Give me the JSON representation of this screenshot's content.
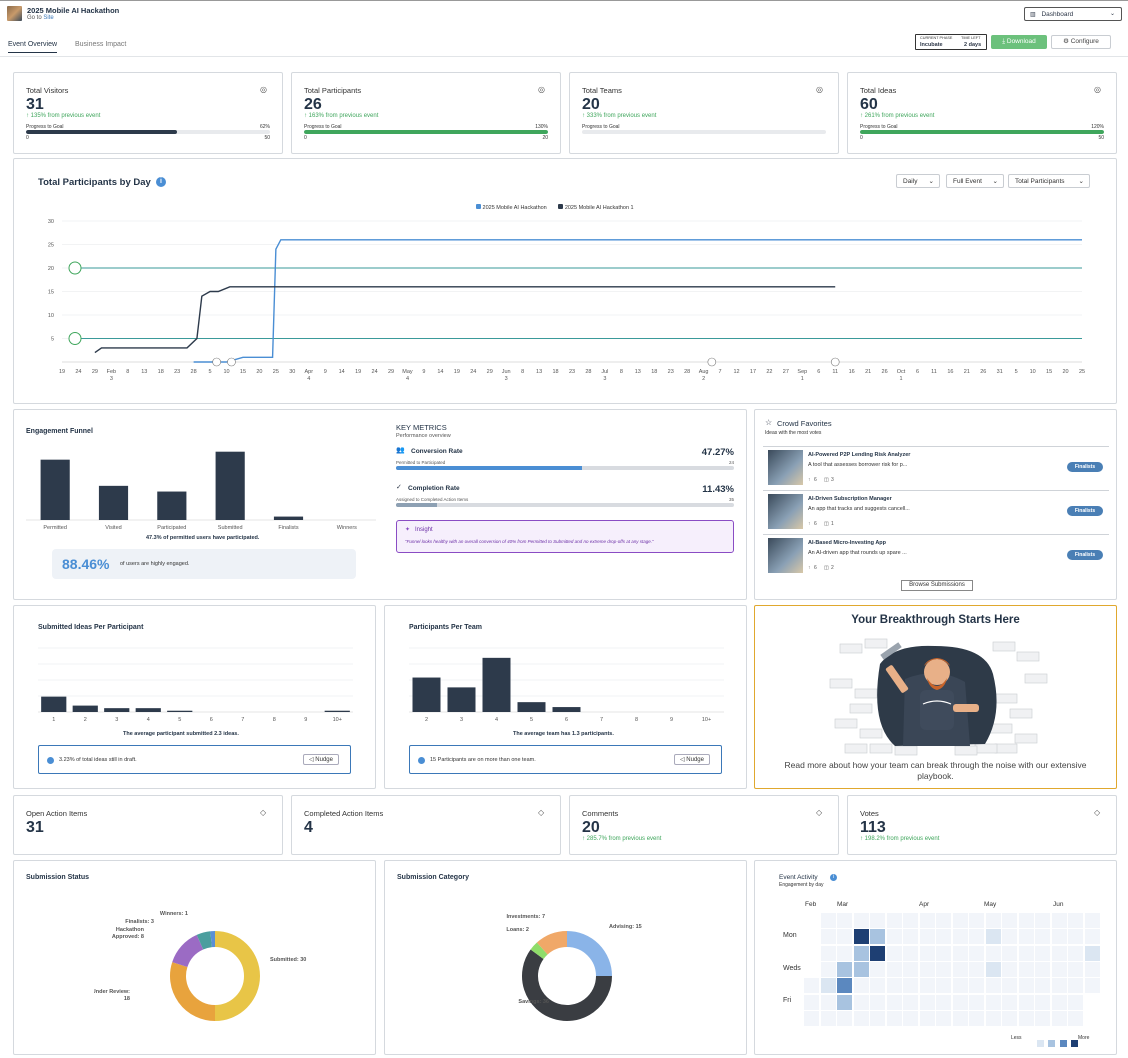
{
  "header": {
    "title": "2025 Mobile AI Hackathon",
    "goto_prefix": "Go to",
    "goto_link": "Site",
    "dashboard_select": "Dashboard"
  },
  "tabs": [
    {
      "label": "Event Overview"
    },
    {
      "label": "Business Impact"
    }
  ],
  "phase": {
    "current_label": "CURRENT PHASE",
    "current_value": "Incubate",
    "time_label": "TIME LEFT",
    "time_value": "2 days"
  },
  "actions": {
    "download": "Download",
    "configure": "Configure"
  },
  "kpis": [
    {
      "title": "Total Visitors",
      "value": "31",
      "delta": "↑ 135% from previous event",
      "goal_label": "Progress to Goal",
      "pct": "62%",
      "progress": 0.62,
      "min": "0",
      "max": "50",
      "bar_color": "#2d3a4b",
      "icon": "eye-icon"
    },
    {
      "title": "Total Participants",
      "value": "26",
      "delta": "↑ 163% from previous event",
      "goal_label": "Progress to Goal",
      "pct": "130%",
      "progress": 1.0,
      "min": "0",
      "max": "20",
      "bar_color": "#3fa65c",
      "icon": "users-icon"
    },
    {
      "title": "Total Teams",
      "value": "20",
      "delta": "↑ 333% from previous event",
      "goal_label": "Progress to Goal",
      "pct": "",
      "progress": 0,
      "min": "",
      "max": "",
      "bar_color": "#3fa65c",
      "icon": "handshake-icon"
    },
    {
      "title": "Total Ideas",
      "value": "60",
      "delta": "↑ 261% from previous event",
      "goal_label": "Progress to Goal",
      "pct": "120%",
      "progress": 1.0,
      "min": "0",
      "max": "50",
      "bar_color": "#3fa65c",
      "icon": "lightbulb-icon"
    }
  ],
  "line_chart": {
    "title": "Total Participants by Day",
    "selects": [
      "Daily",
      "Full Event",
      "Total Participants"
    ],
    "chart_data": {
      "type": "line",
      "ylim": [
        0,
        30
      ],
      "yticks": [
        5,
        10,
        15,
        20,
        25,
        30
      ],
      "x_ticks": [
        "19",
        "24",
        "29",
        "Feb",
        "8",
        "13",
        "18",
        "23",
        "28",
        "5",
        "10",
        "15",
        "20",
        "25",
        "30",
        "Apr",
        "9",
        "14",
        "19",
        "24",
        "29",
        "May",
        "9",
        "14",
        "19",
        "24",
        "29",
        "Jun",
        "8",
        "13",
        "18",
        "23",
        "28",
        "Jul",
        "8",
        "13",
        "18",
        "23",
        "28",
        "Aug",
        "7",
        "12",
        "17",
        "22",
        "27",
        "Sep",
        "6",
        "11",
        "16",
        "21",
        "26",
        "Oct",
        "6",
        "11",
        "16",
        "21",
        "26",
        "31",
        "5",
        "10",
        "15",
        "20",
        "25"
      ],
      "x_sub": {
        "3": "3",
        "15": "4",
        "21": "4",
        "27": "3",
        "33": "3",
        "39": "2",
        "45": "1",
        "51": "1"
      },
      "series": [
        {
          "name": "2025 Mobile AI Hackathon",
          "color": "#4a8ed4",
          "points": [
            [
              8,
              0
            ],
            [
              9,
              0
            ],
            [
              10,
              0
            ],
            [
              11,
              1
            ],
            [
              12,
              1
            ],
            [
              12.8,
              1
            ],
            [
              13,
              24
            ],
            [
              13.3,
              26
            ],
            [
              14,
              26
            ],
            [
              62,
              26
            ]
          ]
        },
        {
          "name": "2025 Mobile AI Hackathon 1",
          "color": "#2d3a4b",
          "points": [
            [
              2,
              2
            ],
            [
              2.4,
              3
            ],
            [
              6,
              3
            ],
            [
              7.6,
              3
            ],
            [
              8.2,
              5
            ],
            [
              8.5,
              14
            ],
            [
              9,
              15
            ],
            [
              9.5,
              15
            ],
            [
              10.2,
              16
            ],
            [
              11,
              16
            ],
            [
              47,
              16
            ]
          ]
        }
      ],
      "goal_lines": [
        20,
        5
      ]
    }
  },
  "funnel": {
    "title": "Engagement Funnel",
    "chart_data": {
      "type": "bar",
      "categories": [
        "Permitted",
        "Visited",
        "Participated",
        "Submitted",
        "Finalists",
        "Winners"
      ],
      "values": [
        53,
        30,
        25,
        60,
        3,
        0
      ],
      "ylim": [
        0,
        65
      ]
    },
    "caption": "47.3% of permitted users have participated.",
    "engaged_pct": "88.46%",
    "engaged_text": "of users are highly engaged."
  },
  "key_metrics": {
    "title": "KEY METRICS",
    "subtitle": "Performance overview",
    "items": [
      {
        "label": "Conversion Rate",
        "value": "47.27%",
        "sub": "Permitted to Participated",
        "max": "24",
        "progress": 0.55,
        "color": "#4a8ed4",
        "icon": "users-icon"
      },
      {
        "label": "Completion Rate",
        "value": "11.43%",
        "sub": "Assigned to Completed Action Items",
        "max": "35",
        "progress": 0.12,
        "color": "#8da0b3",
        "icon": "check-icon"
      }
    ],
    "insight_title": "Insight",
    "insight_text": "\"Funnel looks healthy with an overall conversion of 40% from Permitted to Submitted and no extreme drop-offs at any stage.\""
  },
  "crowd": {
    "title": "Crowd Favorites",
    "subtitle": "Ideas with the most votes",
    "items": [
      {
        "name": "AI-Powered P2P Lending Risk Analyzer",
        "desc": "A tool that assesses borrower risk for p...",
        "votes": "6",
        "comments": "3",
        "badge": "Finalists"
      },
      {
        "name": "AI-Driven Subscription Manager",
        "desc": "An app that tracks and suggests cancell...",
        "votes": "6",
        "comments": "1",
        "badge": "Finalists"
      },
      {
        "name": "AI-Based Micro-Investing App",
        "desc": "An AI-driven app that rounds up spare ...",
        "votes": "6",
        "comments": "2",
        "badge": "Finalists"
      }
    ],
    "browse": "Browse Submissions"
  },
  "ideas_per_participant": {
    "title": "Submitted Ideas Per Participant",
    "chart_data": {
      "type": "bar",
      "categories": [
        "1",
        "2",
        "3",
        "4",
        "5",
        "6",
        "7",
        "8",
        "9",
        "10+"
      ],
      "values": [
        12,
        5,
        3,
        3,
        1,
        0,
        0,
        0,
        0,
        1
      ],
      "ylim": [
        0,
        50
      ]
    },
    "caption": "The average participant submitted 2.3 ideas.",
    "info": "3.23% of total ideas still in draft.",
    "nudge": "Nudge"
  },
  "participants_per_team": {
    "title": "Participants Per Team",
    "chart_data": {
      "type": "bar",
      "categories": [
        "2",
        "3",
        "4",
        "5",
        "6",
        "7",
        "8",
        "9",
        "10+"
      ],
      "values": [
        7,
        5,
        11,
        2,
        1,
        0,
        0,
        0,
        0
      ],
      "ylim": [
        0,
        13
      ]
    },
    "caption": "The average team has 1.3 participants.",
    "info": "15 Participants are on more than one team.",
    "nudge": "Nudge"
  },
  "promo": {
    "title": "Your Breakthrough Starts Here",
    "text": "Read more about how your team can break through the noise with our extensive playbook."
  },
  "small_kpis": [
    {
      "title": "Open Action Items",
      "value": "31",
      "delta": "",
      "icon": "target-icon"
    },
    {
      "title": "Completed Action Items",
      "value": "4",
      "delta": "",
      "icon": "crosshair-icon"
    },
    {
      "title": "Comments",
      "value": "20",
      "delta": "↑ 285.7% from previous event",
      "icon": "comment-icon"
    },
    {
      "title": "Votes",
      "value": "113",
      "delta": "↑ 198.2% from previous event",
      "icon": "arrow-up-icon"
    }
  ],
  "submission_status": {
    "title": "Submission Status",
    "chart_data": {
      "type": "pie",
      "labels": [
        "Submitted: 30",
        "Under Review: 18",
        "Hackathon Approved: 8",
        "Finalists: 3",
        "Winners: 1"
      ],
      "values": [
        30,
        18,
        8,
        3,
        1
      ],
      "colors": [
        "#e8c547",
        "#e8a33d",
        "#9b6bc4",
        "#4a9e9e",
        "#5b8fd4"
      ]
    }
  },
  "submission_category": {
    "title": "Submission Category",
    "chart_data": {
      "type": "pie",
      "labels": [
        "Advising: 15",
        "Savings: 36",
        "Loans: 2",
        "Investments: 7"
      ],
      "values": [
        15,
        36,
        2,
        7
      ],
      "colors": [
        "#8ab4e8",
        "#3a3d42",
        "#8fdc6a",
        "#f0a868"
      ]
    }
  },
  "activity": {
    "title": "Event Activity",
    "subtitle": "Engagement by day",
    "months": [
      "Feb",
      "Mar",
      "Apr",
      "May",
      "Jun"
    ],
    "days": [
      "Mon",
      "Weds",
      "Fri"
    ],
    "less": "Less",
    "more": "More"
  }
}
